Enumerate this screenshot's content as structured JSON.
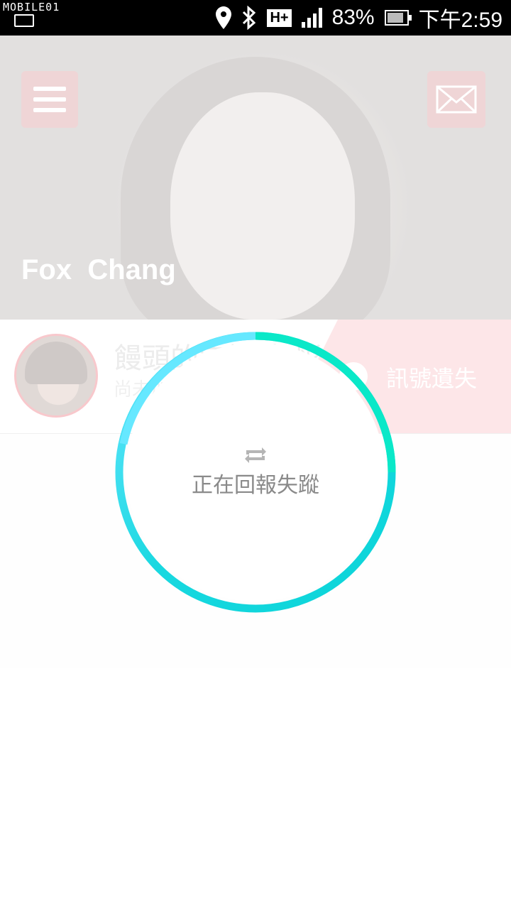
{
  "status_bar": {
    "watermark": "MOBILE01",
    "battery": "83%",
    "time": "下午2:59",
    "network": "H+"
  },
  "header": {
    "user_name": "Fox  Chang"
  },
  "member": {
    "name": "饅頭的守護神-彤",
    "status": "尚未加入守護",
    "signal_status": "訊號遺失"
  },
  "report": {
    "label": "正在回報失蹤"
  },
  "colors": {
    "ring_start": "#5ee8ff",
    "ring_end": "#0ae0c8",
    "accent_pink": "#fde6e8"
  }
}
